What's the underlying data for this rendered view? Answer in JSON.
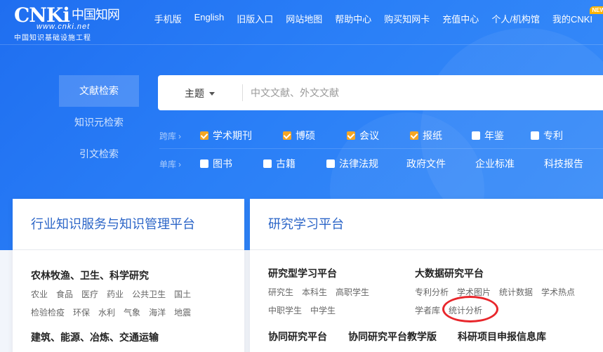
{
  "header": {
    "logo_mark": "CNKi",
    "logo_cn": "中国知网",
    "logo_url": "www.cnki.net",
    "logo_sub": "中国知识基础设施工程",
    "nav": [
      "手机版",
      "English",
      "旧版入口",
      "网站地图",
      "帮助中心",
      "购买知网卡",
      "充值中心",
      "个人/机构馆",
      "我的CNKI"
    ],
    "new_badge": "NEW"
  },
  "search": {
    "tabs": [
      "文献检索",
      "知识元检索",
      "引文检索"
    ],
    "scope": "主题",
    "placeholder": "中文文献、外文文献",
    "cross_label": "跨库",
    "single_label": "单库",
    "cross_dbs": [
      {
        "label": "学术期刊",
        "checked": true
      },
      {
        "label": "博硕",
        "checked": true
      },
      {
        "label": "会议",
        "checked": true
      },
      {
        "label": "报纸",
        "checked": true
      },
      {
        "label": "年鉴",
        "checked": false
      },
      {
        "label": "专利",
        "checked": false
      }
    ],
    "single_dbs": [
      {
        "label": "图书",
        "checkbox": true
      },
      {
        "label": "古籍",
        "checkbox": true
      },
      {
        "label": "法律法规",
        "checkbox": true
      },
      {
        "label": "政府文件",
        "checkbox": false
      },
      {
        "label": "企业标准",
        "checkbox": false
      },
      {
        "label": "科技报告",
        "checkbox": false
      }
    ]
  },
  "left_card": {
    "title": "行业知识服务与知识管理平台",
    "cat1_title": "农林牧渔、卫生、科学研究",
    "cat1_tags": [
      "农业",
      "食品",
      "医疗",
      "药业",
      "公共卫生",
      "国土",
      "检验检疫",
      "环保",
      "水利",
      "气象",
      "海洋",
      "地震"
    ],
    "cat2_title": "建筑、能源、冶炼、交通运输"
  },
  "right_card": {
    "title": "研究学习平台",
    "col1_title": "研究型学习平台",
    "col1_tags": [
      "研究生",
      "本科生",
      "高职学生",
      "中职学生",
      "中学生"
    ],
    "col2_title": "大数据研究平台",
    "col2_tags": [
      "专利分析",
      "学术图片",
      "统计数据",
      "学术热点",
      "学者库",
      "统计分析"
    ],
    "bottom": [
      "协同研究平台",
      "协同研究平台教学版",
      "科研项目申报信息库"
    ]
  },
  "colors": {
    "brand_blue": "#2a7ff7",
    "check_orange": "#f5a623",
    "title_blue": "#2a64c7",
    "annotation_red": "#e8262b"
  }
}
